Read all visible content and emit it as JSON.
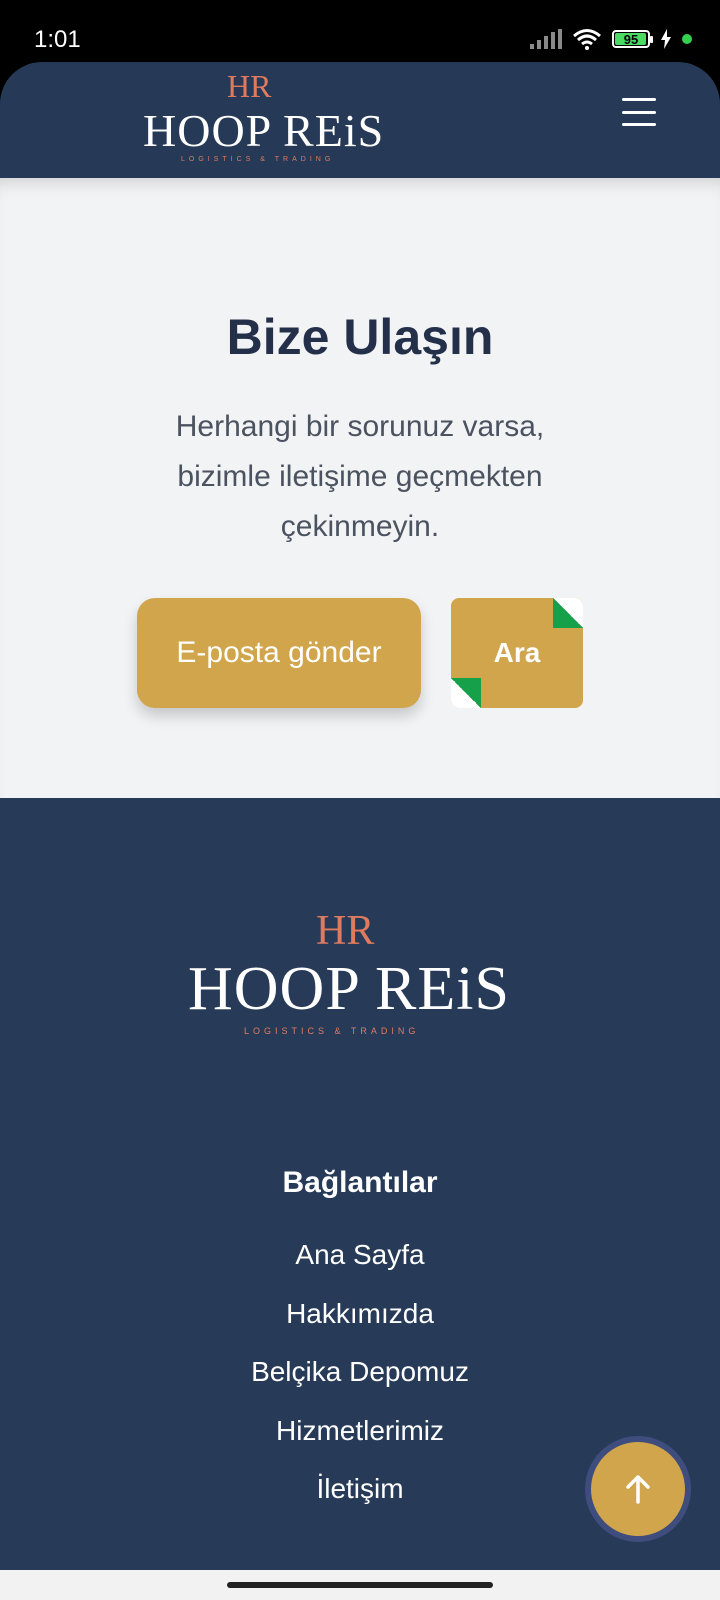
{
  "status_bar": {
    "time": "1:01",
    "battery": "95"
  },
  "header": {
    "logo_mark": "HR",
    "logo_text": "HOOP REiS",
    "logo_sub": "LOGISTICS & TRADING"
  },
  "contact": {
    "title": "Bize Ulaşın",
    "description": "Herhangi bir sorunuz varsa, bizimle iletişime geçmekten çekinmeyin.",
    "email_button": "E-posta gönder",
    "call_button": "Ara"
  },
  "footer": {
    "logo_mark": "HR",
    "logo_text": "HOOP REiS",
    "logo_sub": "LOGISTICS & TRADING",
    "links_title": "Bağlantılar",
    "links": [
      "Ana Sayfa",
      "Hakkımızda",
      "Belçika Depomuz",
      "Hizmetlerimiz",
      "İletişim"
    ]
  },
  "colors": {
    "header_bg": "#263a57",
    "accent_gold": "#d0a54b",
    "logo_orange": "#e07a5f",
    "section_bg": "#f2f3f5"
  }
}
